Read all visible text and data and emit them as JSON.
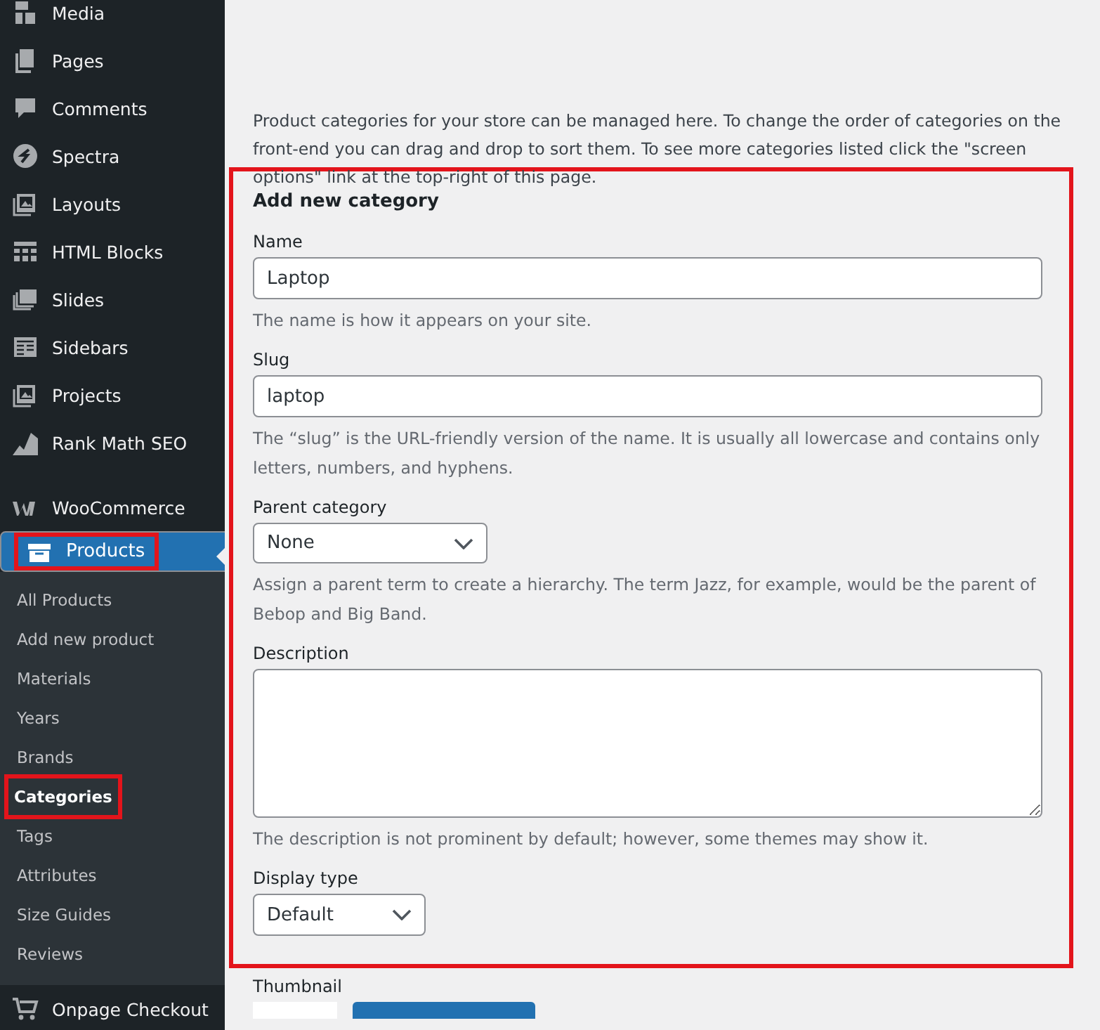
{
  "sidebar": {
    "items": [
      {
        "label": "Media",
        "selected": false,
        "highlighted": false
      },
      {
        "label": "Pages",
        "selected": false,
        "highlighted": false
      },
      {
        "label": "Comments",
        "selected": false,
        "highlighted": false
      },
      {
        "label": "Spectra",
        "selected": false,
        "highlighted": false
      },
      {
        "label": "Layouts",
        "selected": false,
        "highlighted": false
      },
      {
        "label": "HTML Blocks",
        "selected": false,
        "highlighted": false
      },
      {
        "label": "Slides",
        "selected": false,
        "highlighted": false
      },
      {
        "label": "Sidebars",
        "selected": false,
        "highlighted": false
      },
      {
        "label": "Projects",
        "selected": false,
        "highlighted": false
      },
      {
        "label": "Rank Math SEO",
        "selected": false,
        "highlighted": false
      },
      {
        "label": "WooCommerce",
        "selected": false,
        "highlighted": false
      },
      {
        "label": "Products",
        "selected": true,
        "highlighted": true,
        "children": [
          {
            "label": "All Products",
            "selected": false,
            "highlighted": false
          },
          {
            "label": "Add new product",
            "selected": false,
            "highlighted": false
          },
          {
            "label": "Materials",
            "selected": false,
            "highlighted": false
          },
          {
            "label": "Years",
            "selected": false,
            "highlighted": false
          },
          {
            "label": "Brands",
            "selected": false,
            "highlighted": false
          },
          {
            "label": "Categories",
            "selected": true,
            "highlighted": true
          },
          {
            "label": "Tags",
            "selected": false,
            "highlighted": false
          },
          {
            "label": "Attributes",
            "selected": false,
            "highlighted": false
          },
          {
            "label": "Size Guides",
            "selected": false,
            "highlighted": false
          },
          {
            "label": "Reviews",
            "selected": false,
            "highlighted": false
          }
        ]
      },
      {
        "label": "Onpage Checkout",
        "selected": false,
        "highlighted": false
      }
    ]
  },
  "intro": "Product categories for your store can be managed here. To change the order of categories on the front-end you can drag and drop to sort them. To see more categories listed click the \"screen options\" link at the top-right of this page.",
  "form": {
    "title": "Add new category",
    "highlighted": true,
    "fields": [
      {
        "kind": "text",
        "label": "Name",
        "value": "Laptop",
        "help": "The name is how it appears on your site."
      },
      {
        "kind": "text",
        "label": "Slug",
        "value": "laptop",
        "help": "The “slug” is the URL-friendly version of the name. It is usually all lowercase and contains only letters, numbers, and hyphens."
      },
      {
        "kind": "select",
        "label": "Parent category",
        "value": "None",
        "help": "Assign a parent term to create a hierarchy. The term Jazz, for example, would be the parent of Bebop and Big Band."
      },
      {
        "kind": "textarea",
        "label": "Description",
        "help": "The description is not prominent by default; however, some themes may show it."
      },
      {
        "kind": "select-small",
        "label": "Display type",
        "value": "Default"
      }
    ]
  },
  "thumbnail": {
    "label": "Thumbnail"
  }
}
